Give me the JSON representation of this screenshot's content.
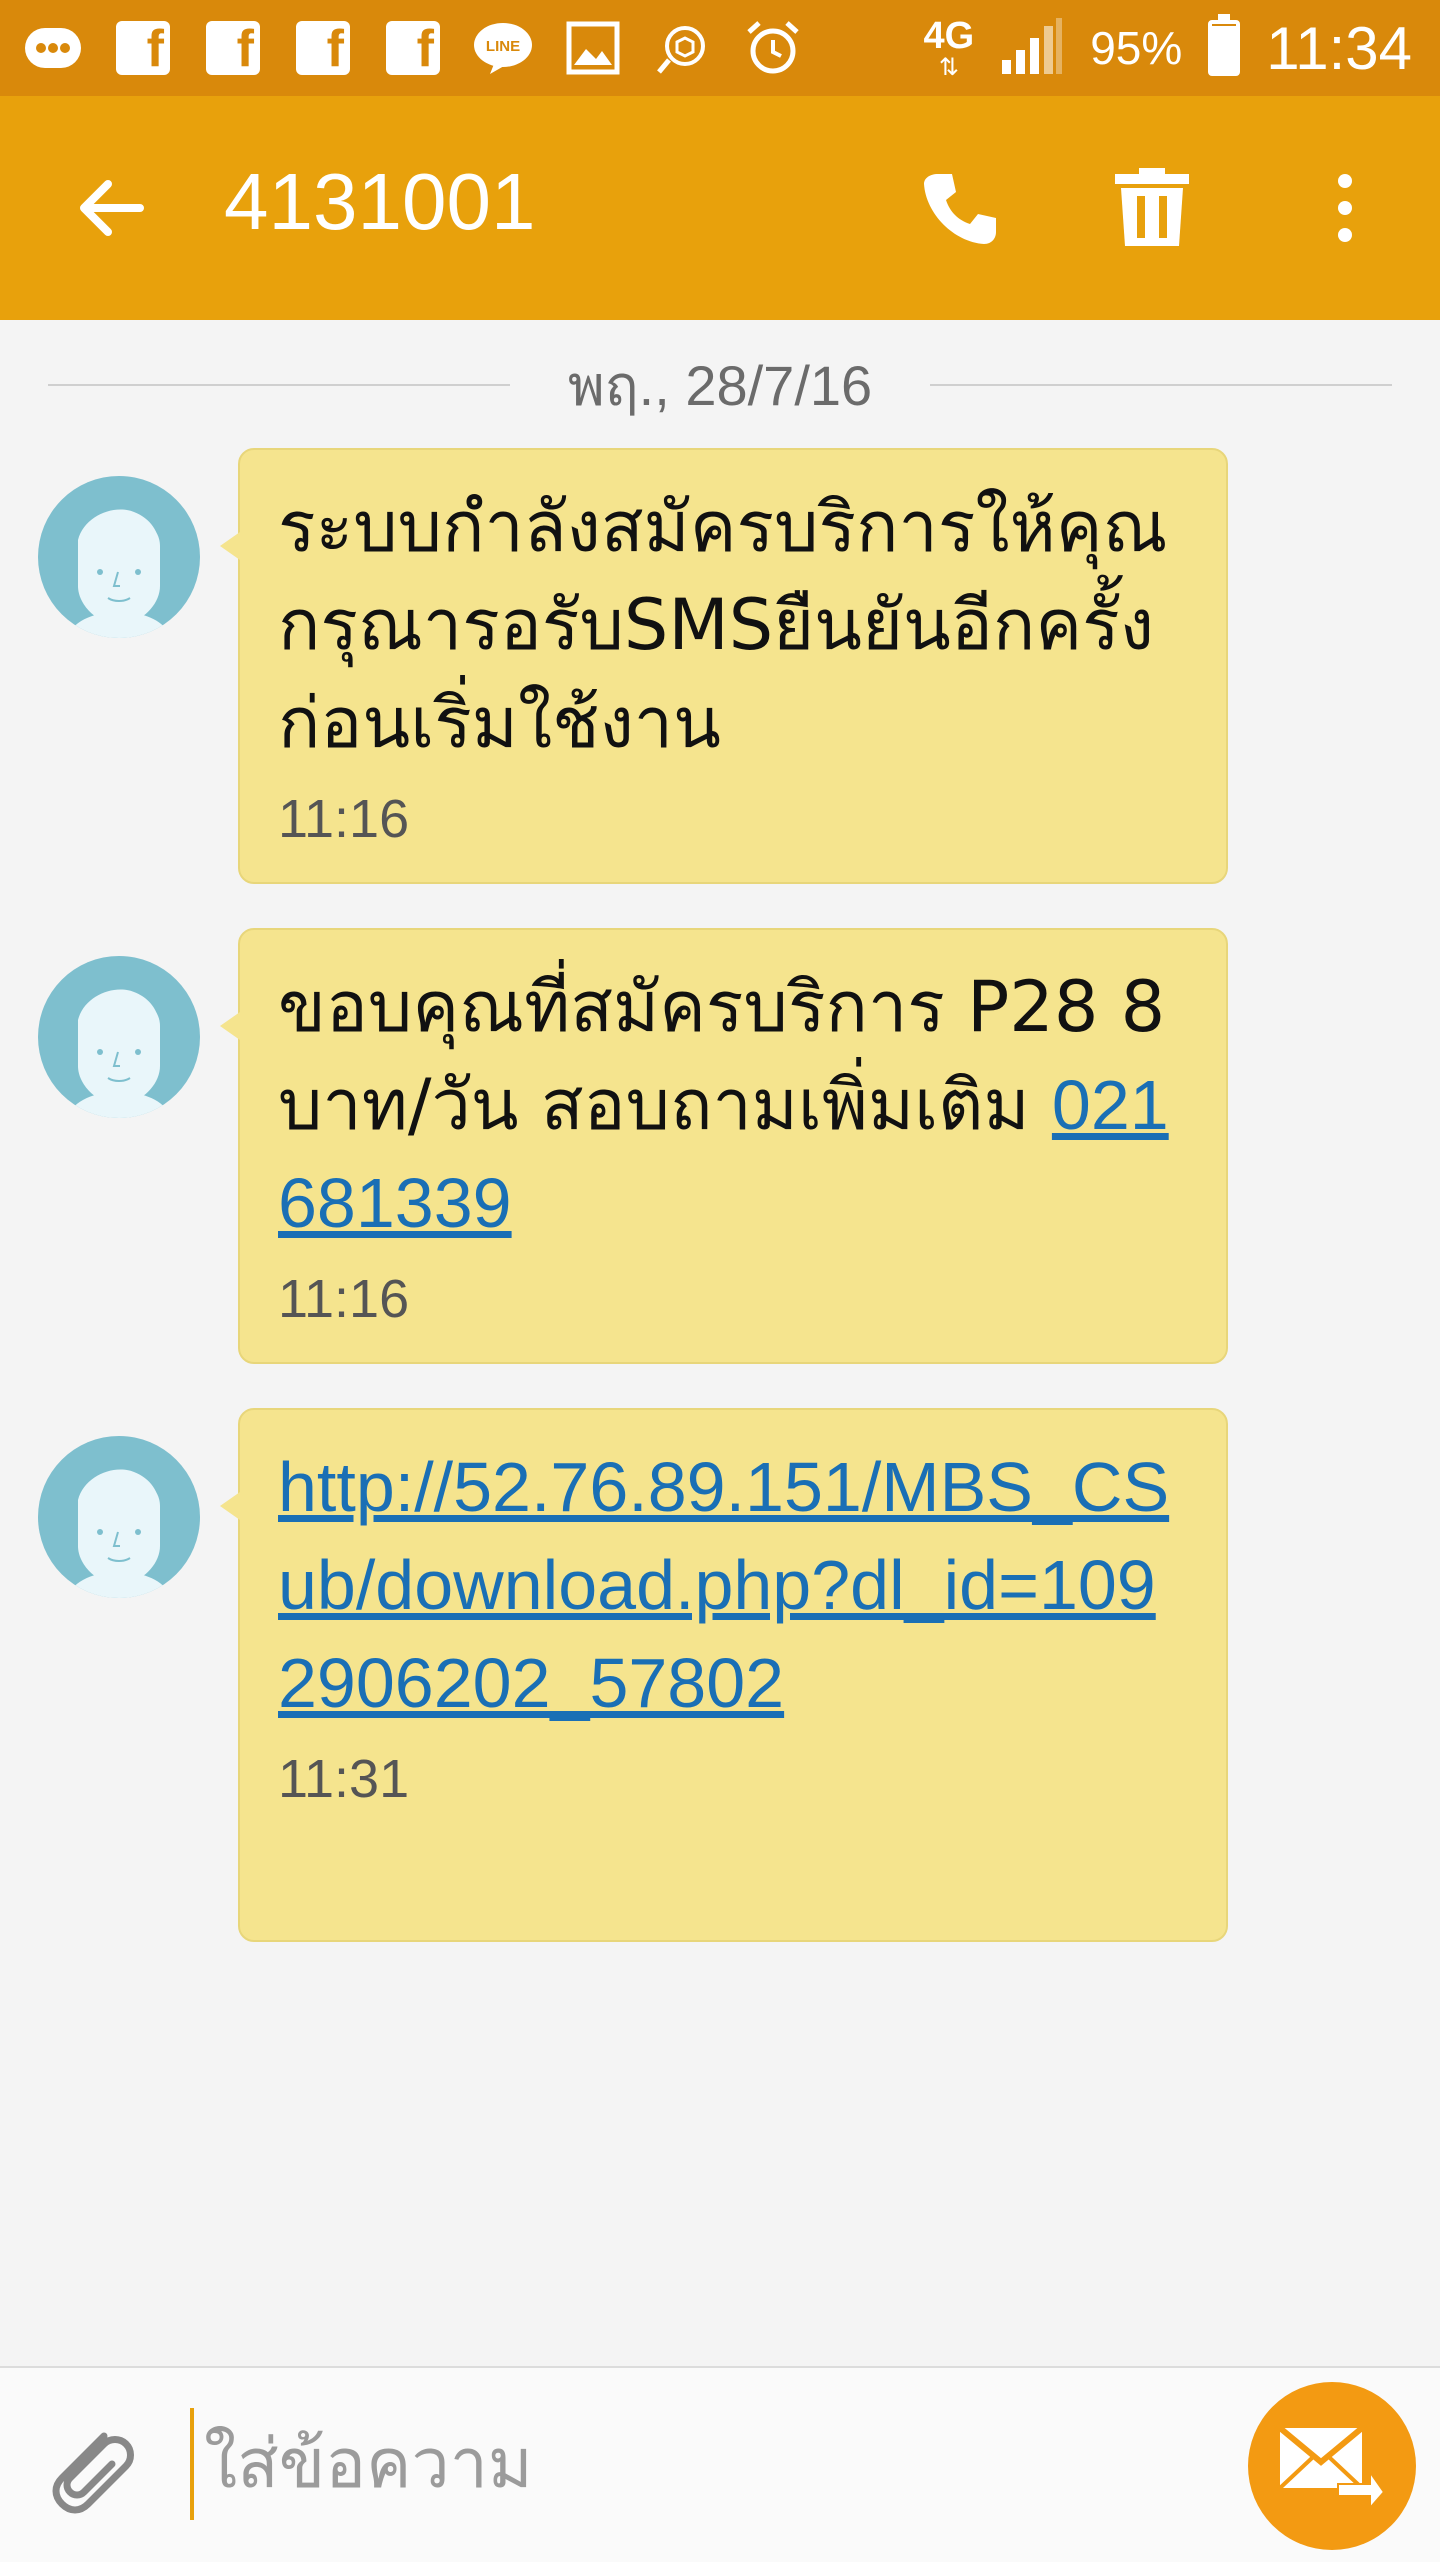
{
  "status_bar": {
    "network": "4G",
    "battery_percent": "95%",
    "battery_level": 0.95,
    "time": "11:34",
    "icons": [
      "more-notifications-icon",
      "facebook-icon",
      "facebook-icon",
      "facebook-icon",
      "facebook-icon",
      "line-icon",
      "gallery-icon",
      "sync-icon",
      "alarm-icon",
      "signal-icon",
      "battery-icon"
    ]
  },
  "header": {
    "title": "4131001",
    "back_icon": "arrow-left-icon",
    "call_icon": "phone-icon",
    "delete_icon": "trash-icon",
    "more_icon": "more-vertical-icon"
  },
  "conversation": {
    "date": "พฤ., 28/7/16",
    "messages": [
      {
        "text": "ระบบกำลังสมัครบริการให้คุณ กรุณารอรับSMSยืนยันอีกครั้งก่อนเริ่มใช้งาน",
        "time": "11:16"
      },
      {
        "text": "ขอบคุณที่สมัครบริการ P28 8 บาท/วัน  สอบถามเพิ่มเติม ",
        "link": "021681339",
        "time": "11:16"
      },
      {
        "link": "http://52.76.89.151/MBS_CSub/download.php?dl_id=1092906202_57802",
        "time": "11:31"
      }
    ]
  },
  "compose": {
    "placeholder": "ใส่ข้อความ",
    "attach_icon": "paperclip-icon",
    "send_icon": "send-message-icon"
  },
  "colors": {
    "status_bar": "#d9890b",
    "app_bar": "#e8a10c",
    "bubble": "#f5e48e",
    "link": "#1a6fb5",
    "send_button": "#f39a12"
  }
}
